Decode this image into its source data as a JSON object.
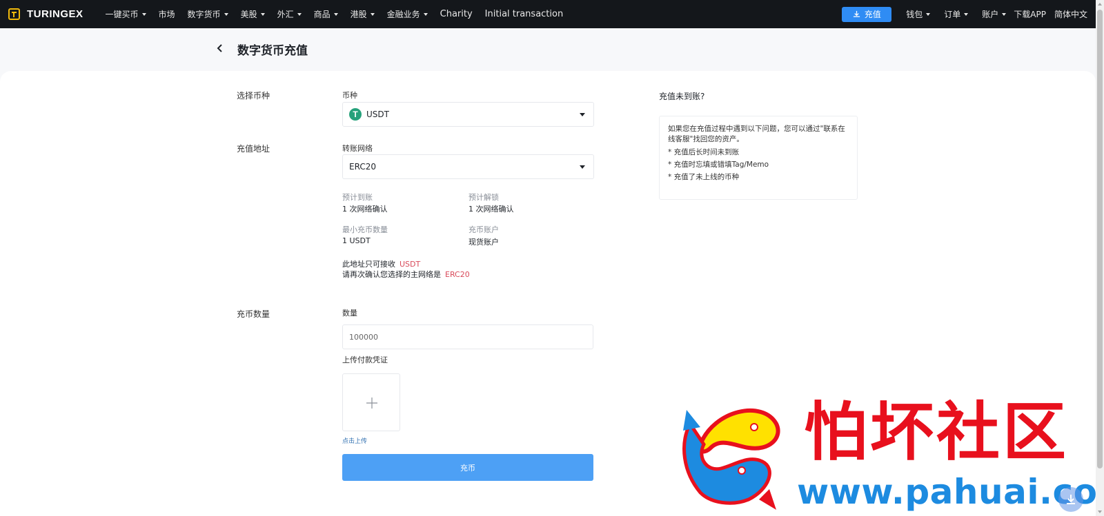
{
  "nav": {
    "logo_text": "TURINGEX",
    "items": [
      {
        "label": "一键买币",
        "caret": true
      },
      {
        "label": "市场",
        "caret": false
      },
      {
        "label": "数字货币",
        "caret": true
      },
      {
        "label": "美股",
        "caret": true
      },
      {
        "label": "外汇",
        "caret": true
      },
      {
        "label": "商品",
        "caret": true
      },
      {
        "label": "港股",
        "caret": true
      },
      {
        "label": "金融业务",
        "caret": true
      },
      {
        "label": "Charity",
        "caret": false
      },
      {
        "label": "Initial transaction",
        "caret": false
      }
    ],
    "deposit_label": "充值",
    "right_items": [
      {
        "label": "钱包",
        "caret": true
      },
      {
        "label": "订单",
        "caret": true
      },
      {
        "label": "账户",
        "caret": true
      },
      {
        "label": "下载APP",
        "caret": false
      },
      {
        "label": "简体中文",
        "caret": false
      }
    ]
  },
  "page": {
    "title": "数字货币充值"
  },
  "form": {
    "section_coin": "选择币种",
    "coin_label": "币种",
    "coin_value": "USDT",
    "coin_icon_glyph": "T",
    "section_address": "充值地址",
    "network_label": "转账网络",
    "network_value": "ERC20",
    "info": {
      "arrival_label": "预计到账",
      "arrival_value": "1 次网络确认",
      "unlock_label": "预计解锁",
      "unlock_value": "1 次网络确认",
      "min_label": "最小充币数量",
      "min_value": "1 USDT",
      "account_label": "充币账户",
      "account_value": "现货账户"
    },
    "note_line1": "此地址只可接收",
    "note_line1_hl": "USDT",
    "note_line2": "请再次确认您选择的主网络是",
    "note_line2_hl": "ERC20",
    "section_amount": "充币数量",
    "qty_label": "数量",
    "qty_value": "100000",
    "upload_label": "上传付款凭证",
    "upload_hint": "点击上传",
    "submit_label": "充币"
  },
  "help": {
    "title": "充值未到账?",
    "intro": "如果您在充值过程中遇到以下问题，您可以通过\"联系在线客服\"找回您的资产。",
    "items": [
      "* 充值后长时间未到账",
      "* 充值时忘填或错填Tag/Memo",
      "* 充值了未上线的币种"
    ]
  },
  "watermark": {
    "cn": "怕坏社区",
    "url": "www.pahuai.com"
  },
  "colors": {
    "nav_bg": "#14171b",
    "accent_blue": "#2f8cf4",
    "submit_blue": "#4da0f5",
    "highlight_red": "#d94a5a",
    "tether_green": "#26a17b"
  }
}
